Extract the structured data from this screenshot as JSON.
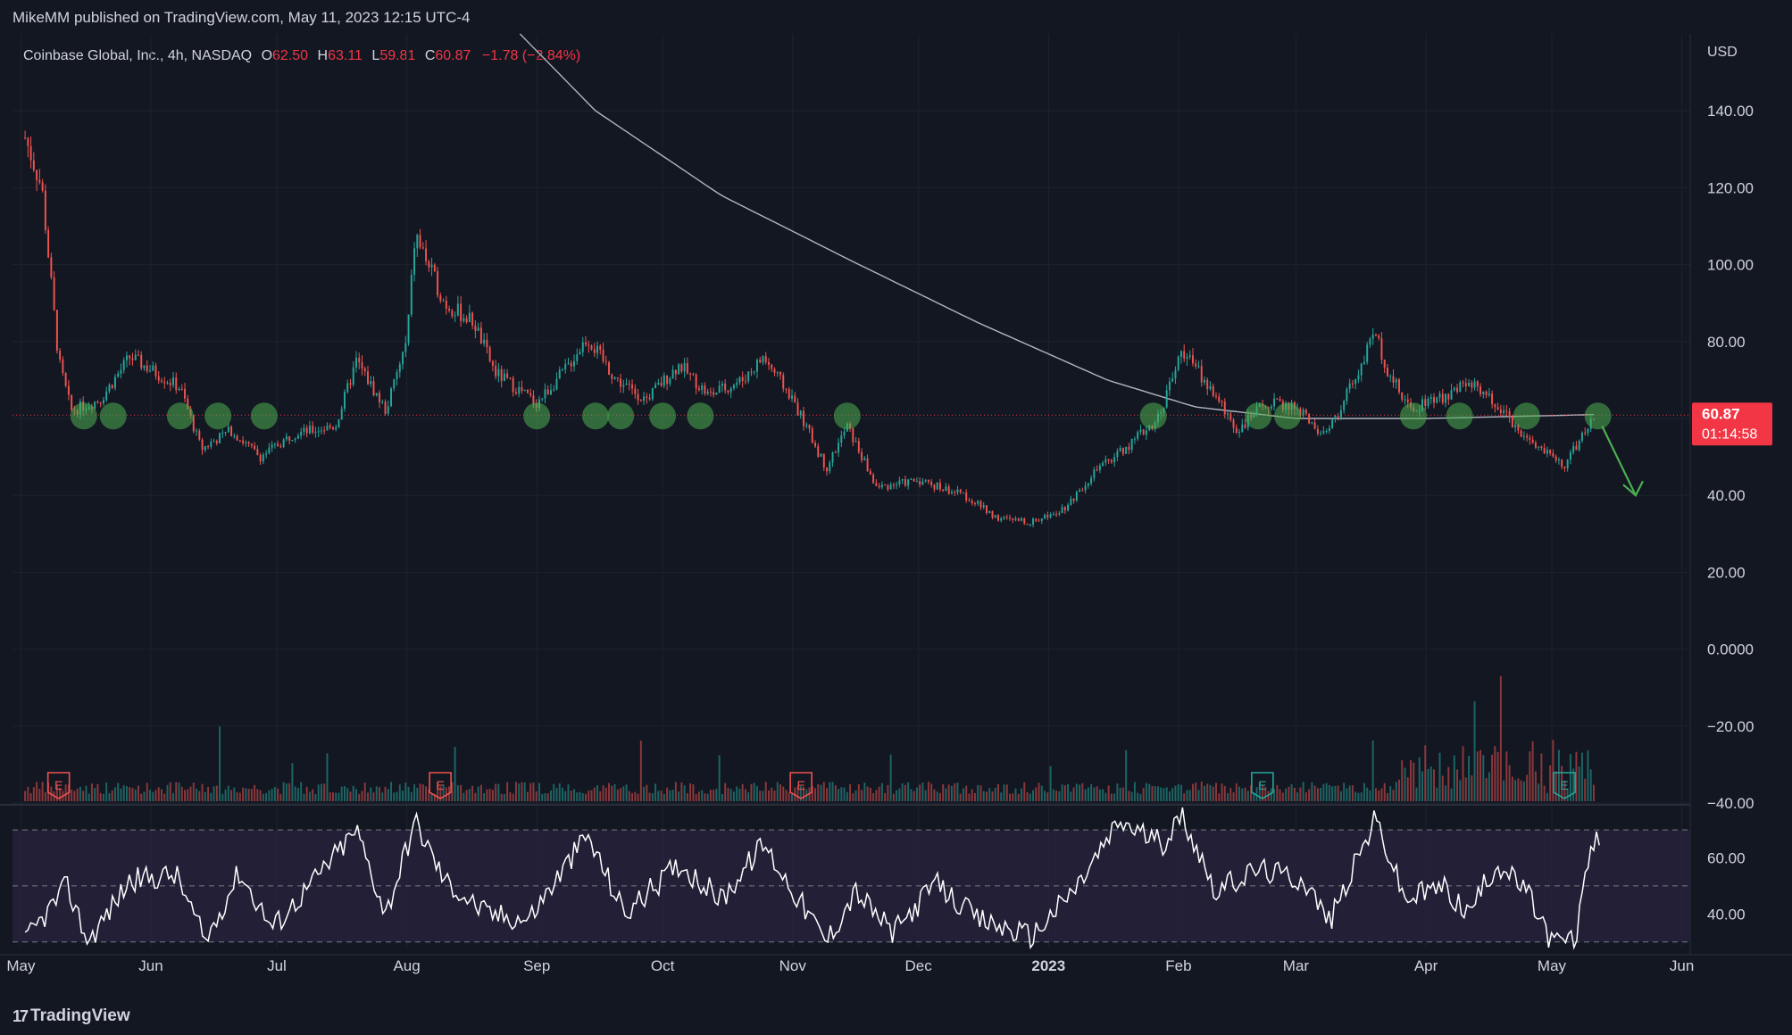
{
  "header": {
    "published_by": "MikeMM published on TradingView.com, May 11, 2023 12:15 UTC-4"
  },
  "legend": {
    "symbol": "Coinbase Global, Inc., 4h, NASDAQ",
    "o_label": "O",
    "o_value": "62.50",
    "h_label": "H",
    "h_value": "63.11",
    "l_label": "L",
    "l_value": "59.81",
    "c_label": "C",
    "c_value": "60.87",
    "change": "−1.78 (−2.84%)"
  },
  "price_axis": {
    "currency": "USD",
    "last_price": "60.87",
    "countdown": "01:14:58"
  },
  "footer": {
    "brand": "TradingView"
  },
  "colors": {
    "background": "#131722",
    "up": "#26a69a",
    "down": "#ef5350",
    "marker": "#4caf50",
    "ma_line": "#b2b5be",
    "rsi_band": "#2a2440",
    "price_tag": "#f23645"
  },
  "chart_data": [
    {
      "type": "candlestick",
      "timeframe": "4h",
      "x_labels": [
        "May",
        "Jun",
        "Jul",
        "Aug",
        "Sep",
        "Oct",
        "Nov",
        "Dec",
        "2023",
        "Feb",
        "Mar",
        "Apr",
        "May",
        "Jun"
      ],
      "y_ticks": [
        140,
        120,
        100,
        80,
        60,
        40,
        20,
        0,
        -20,
        -40
      ],
      "y_tick_labels": [
        "140.00",
        "120.00",
        "100.00",
        "80.00",
        "",
        "40.00",
        "20.00",
        "0.0000",
        "−20.00",
        "−40.00"
      ],
      "ylim": [
        -40,
        160
      ],
      "approx_close_path": [
        {
          "date": "2022-05-02",
          "close": 133
        },
        {
          "date": "2022-05-06",
          "close": 120
        },
        {
          "date": "2022-05-10",
          "close": 75
        },
        {
          "date": "2022-05-13",
          "close": 62
        },
        {
          "date": "2022-05-20",
          "close": 65
        },
        {
          "date": "2022-05-27",
          "close": 76
        },
        {
          "date": "2022-06-08",
          "close": 68
        },
        {
          "date": "2022-06-13",
          "close": 52
        },
        {
          "date": "2022-06-20",
          "close": 57
        },
        {
          "date": "2022-06-27",
          "close": 50
        },
        {
          "date": "2022-07-05",
          "close": 56
        },
        {
          "date": "2022-07-15",
          "close": 58
        },
        {
          "date": "2022-07-20",
          "close": 75
        },
        {
          "date": "2022-07-27",
          "close": 62
        },
        {
          "date": "2022-08-01",
          "close": 80
        },
        {
          "date": "2022-08-03",
          "close": 108
        },
        {
          "date": "2022-08-10",
          "close": 90
        },
        {
          "date": "2022-08-17",
          "close": 85
        },
        {
          "date": "2022-08-22",
          "close": 72
        },
        {
          "date": "2022-09-01",
          "close": 64
        },
        {
          "date": "2022-09-08",
          "close": 73
        },
        {
          "date": "2022-09-13",
          "close": 81
        },
        {
          "date": "2022-09-20",
          "close": 70
        },
        {
          "date": "2022-09-27",
          "close": 65
        },
        {
          "date": "2022-10-05",
          "close": 74
        },
        {
          "date": "2022-10-12",
          "close": 66
        },
        {
          "date": "2022-10-20",
          "close": 70
        },
        {
          "date": "2022-10-25",
          "close": 76
        },
        {
          "date": "2022-11-01",
          "close": 65
        },
        {
          "date": "2022-11-09",
          "close": 47
        },
        {
          "date": "2022-11-14",
          "close": 58
        },
        {
          "date": "2022-11-21",
          "close": 42
        },
        {
          "date": "2022-12-01",
          "close": 44
        },
        {
          "date": "2022-12-12",
          "close": 40
        },
        {
          "date": "2022-12-20",
          "close": 34
        },
        {
          "date": "2022-12-28",
          "close": 33
        },
        {
          "date": "2023-01-05",
          "close": 37
        },
        {
          "date": "2023-01-12",
          "close": 46
        },
        {
          "date": "2023-01-20",
          "close": 53
        },
        {
          "date": "2023-01-27",
          "close": 60
        },
        {
          "date": "2023-02-02",
          "close": 78
        },
        {
          "date": "2023-02-09",
          "close": 67
        },
        {
          "date": "2023-02-15",
          "close": 57
        },
        {
          "date": "2023-02-22",
          "close": 64
        },
        {
          "date": "2023-03-01",
          "close": 63
        },
        {
          "date": "2023-03-08",
          "close": 55
        },
        {
          "date": "2023-03-13",
          "close": 66
        },
        {
          "date": "2023-03-20",
          "close": 82
        },
        {
          "date": "2023-03-23",
          "close": 72
        },
        {
          "date": "2023-03-28",
          "close": 63
        },
        {
          "date": "2023-04-05",
          "close": 65
        },
        {
          "date": "2023-04-11",
          "close": 70
        },
        {
          "date": "2023-04-18",
          "close": 63
        },
        {
          "date": "2023-04-25",
          "close": 55
        },
        {
          "date": "2023-05-04",
          "close": 48
        },
        {
          "date": "2023-05-08",
          "close": 55
        },
        {
          "date": "2023-05-11",
          "close": 60.87
        }
      ],
      "moving_average_path": [
        {
          "date": "2022-08-28",
          "value": 160
        },
        {
          "date": "2022-09-15",
          "value": 140
        },
        {
          "date": "2022-10-15",
          "value": 118
        },
        {
          "date": "2022-11-15",
          "value": 101
        },
        {
          "date": "2022-12-15",
          "value": 85
        },
        {
          "date": "2023-01-15",
          "value": 70
        },
        {
          "date": "2023-02-05",
          "value": 63
        },
        {
          "date": "2023-03-01",
          "value": 60
        },
        {
          "date": "2023-04-01",
          "value": 60
        },
        {
          "date": "2023-05-11",
          "value": 61
        }
      ],
      "horizontal_level": 60.87,
      "touch_markers": [
        "2022-05-16",
        "2022-05-23",
        "2022-06-08",
        "2022-06-17",
        "2022-06-28",
        "2022-09-01",
        "2022-09-15",
        "2022-09-21",
        "2022-10-01",
        "2022-10-10",
        "2022-11-14",
        "2023-01-26",
        "2023-02-20",
        "2023-02-27",
        "2023-03-29",
        "2023-04-09",
        "2023-04-25",
        "2023-05-12"
      ],
      "earnings_markers": [
        {
          "date": "2022-05-10",
          "label": "E"
        },
        {
          "date": "2022-08-09",
          "label": "E"
        },
        {
          "date": "2022-11-03",
          "label": "E"
        },
        {
          "date": "2023-02-21",
          "label": "E"
        },
        {
          "date": "2023-05-04",
          "label": "E"
        }
      ],
      "volume_relative": "spikes near 2023-04 and 2023-05 (up to roughly 4x baseline)",
      "projection_arrow": {
        "from": {
          "date": "2023-05-13",
          "price": 58
        },
        "to": {
          "date": "2023-05-21",
          "price": 40
        }
      }
    },
    {
      "type": "line",
      "name": "",
      "y_ticks": [
        60,
        40
      ],
      "y_tick_labels": [
        "60.00",
        "40.00"
      ],
      "band": [
        30,
        70
      ],
      "ylim": [
        28,
        78
      ],
      "approx_path": [
        {
          "date": "2022-05-02",
          "value": 30
        },
        {
          "date": "2022-05-12",
          "value": 50
        },
        {
          "date": "2022-05-17",
          "value": 30
        },
        {
          "date": "2022-05-27",
          "value": 52
        },
        {
          "date": "2022-06-07",
          "value": 54
        },
        {
          "date": "2022-06-14",
          "value": 30
        },
        {
          "date": "2022-06-22",
          "value": 55
        },
        {
          "date": "2022-06-30",
          "value": 35
        },
        {
          "date": "2022-07-10",
          "value": 52
        },
        {
          "date": "2022-07-20",
          "value": 70
        },
        {
          "date": "2022-07-27",
          "value": 40
        },
        {
          "date": "2022-08-03",
          "value": 73
        },
        {
          "date": "2022-08-10",
          "value": 52
        },
        {
          "date": "2022-08-20",
          "value": 40
        },
        {
          "date": "2022-08-30",
          "value": 38
        },
        {
          "date": "2022-09-13",
          "value": 68
        },
        {
          "date": "2022-09-22",
          "value": 40
        },
        {
          "date": "2022-10-05",
          "value": 58
        },
        {
          "date": "2022-10-15",
          "value": 45
        },
        {
          "date": "2022-10-25",
          "value": 65
        },
        {
          "date": "2022-11-09",
          "value": 30
        },
        {
          "date": "2022-11-16",
          "value": 48
        },
        {
          "date": "2022-11-25",
          "value": 33
        },
        {
          "date": "2022-12-05",
          "value": 51
        },
        {
          "date": "2022-12-15",
          "value": 38
        },
        {
          "date": "2022-12-28",
          "value": 32
        },
        {
          "date": "2023-01-08",
          "value": 50
        },
        {
          "date": "2023-01-18",
          "value": 73
        },
        {
          "date": "2023-01-28",
          "value": 65
        },
        {
          "date": "2023-02-02",
          "value": 75
        },
        {
          "date": "2023-02-10",
          "value": 48
        },
        {
          "date": "2023-02-20",
          "value": 56
        },
        {
          "date": "2023-03-03",
          "value": 52
        },
        {
          "date": "2023-03-09",
          "value": 37
        },
        {
          "date": "2023-03-20",
          "value": 74
        },
        {
          "date": "2023-03-27",
          "value": 45
        },
        {
          "date": "2023-04-05",
          "value": 50
        },
        {
          "date": "2023-04-11",
          "value": 40
        },
        {
          "date": "2023-04-18",
          "value": 58
        },
        {
          "date": "2023-04-25",
          "value": 48
        },
        {
          "date": "2023-05-01",
          "value": 30
        },
        {
          "date": "2023-05-07",
          "value": 31
        },
        {
          "date": "2023-05-09",
          "value": 58
        },
        {
          "date": "2023-05-12",
          "value": 66
        },
        {
          "date": "2023-05-13",
          "value": 61
        }
      ]
    }
  ]
}
